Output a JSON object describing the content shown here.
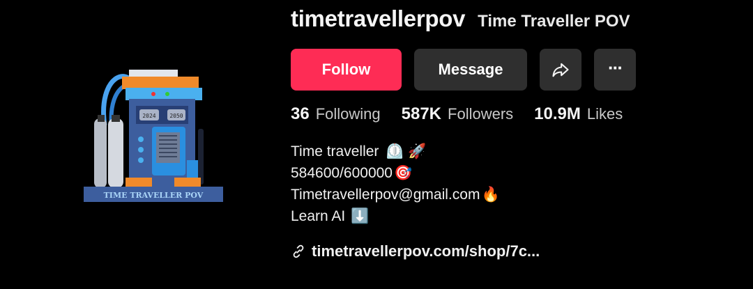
{
  "profile": {
    "username": "timetravellerpov",
    "display_name": "Time Traveller POV",
    "avatar_text": "TIME TRAVELLER POV",
    "avatar_screen_left": "2024",
    "avatar_screen_right": "2050"
  },
  "actions": {
    "follow_label": "Follow",
    "message_label": "Message",
    "more_label": "···"
  },
  "stats": {
    "following_count": "36",
    "following_label": "Following",
    "followers_count": "587K",
    "followers_label": "Followers",
    "likes_count": "10.9M",
    "likes_label": "Likes"
  },
  "bio": {
    "line1": "Time traveller",
    "line1_emojis": "⏲️ 🚀",
    "line2": "584600/600000",
    "line2_emoji": "🎯",
    "line3": "Timetravellerpov@gmail.com",
    "line3_emoji": "🔥",
    "line4": "Learn AI",
    "line4_emoji": "⬇️"
  },
  "link": {
    "text": "timetravellerpov.com/shop/7c..."
  },
  "colors": {
    "background": "#000000",
    "follow_button": "#fe2c55",
    "secondary_button": "#2f2f2f",
    "text_primary": "#f5f5f5",
    "text_secondary": "#c9c9c9"
  }
}
